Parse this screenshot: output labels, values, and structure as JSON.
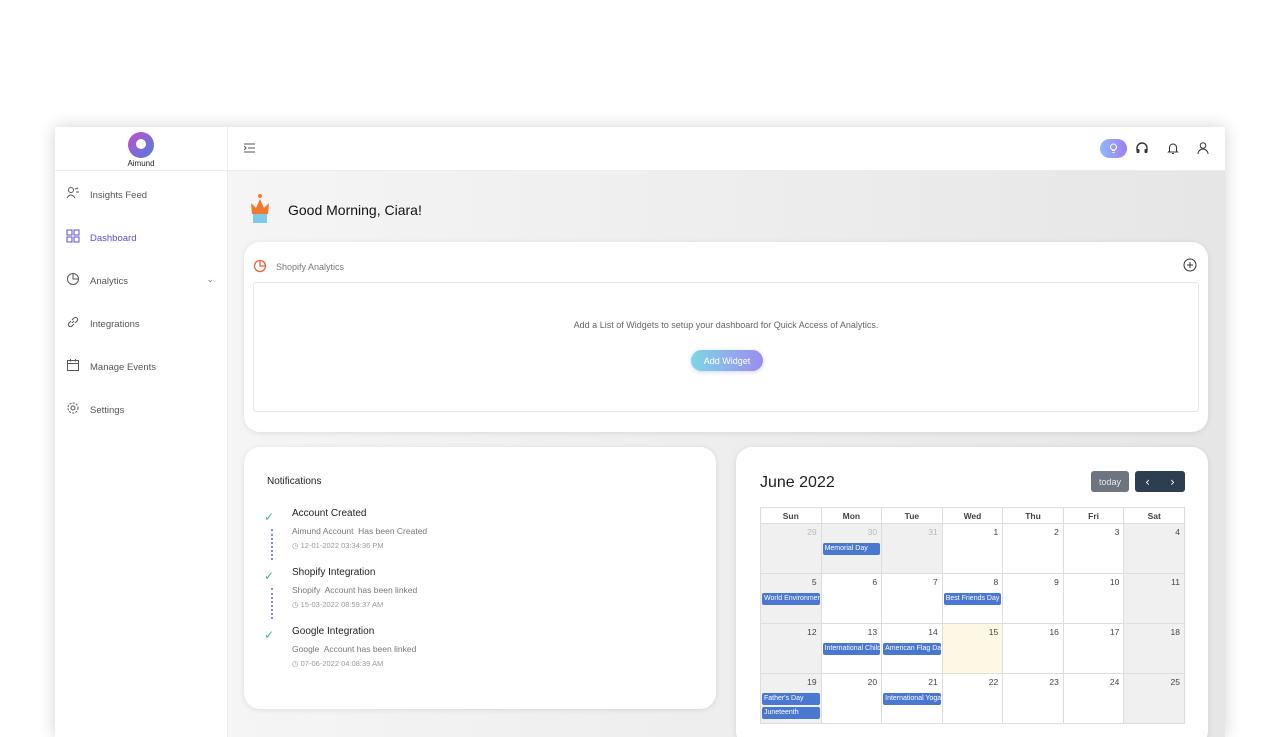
{
  "app": {
    "logo_text": "Aimund"
  },
  "sidebar": {
    "items": [
      {
        "label": "Insights Feed",
        "icon": "insights-icon",
        "active": false
      },
      {
        "label": "Dashboard",
        "icon": "grid-icon",
        "active": true
      },
      {
        "label": "Analytics",
        "icon": "pie-chart-icon",
        "active": false,
        "expandable": true
      },
      {
        "label": "Integrations",
        "icon": "link-icon",
        "active": false
      },
      {
        "label": "Manage Events",
        "icon": "calendar-icon",
        "active": false
      },
      {
        "label": "Settings",
        "icon": "gear-icon",
        "active": false
      }
    ]
  },
  "header": {
    "icons": [
      "menu-toggle-icon",
      "bulb-icon",
      "headphones-icon",
      "bell-icon",
      "user-icon"
    ]
  },
  "main": {
    "greeting": "Good Morning, Ciara!"
  },
  "shopify": {
    "title": "Shopify Analytics",
    "empty_message": "Add a List of Widgets to setup your dashboard for Quick Access of Analytics.",
    "add_widget_label": "Add Widget"
  },
  "notifications": {
    "title": "Notifications",
    "items": [
      {
        "title": "Account Created",
        "source": "Aimund Account",
        "message": "Has been Created",
        "time": "12-01-2022 03:34:36 PM"
      },
      {
        "title": "Shopify Integration",
        "source": "Shopify",
        "message": "Account has been linked",
        "time": "15-03-2022 08:59:37 AM"
      },
      {
        "title": "Google Integration",
        "source": "Google",
        "message": "Account has been linked",
        "time": "07-06-2022 04:08:39 AM"
      }
    ]
  },
  "calendar": {
    "title": "June 2022",
    "today_label": "today",
    "prev_label": "‹",
    "next_label": "›",
    "weekdays": [
      "Sun",
      "Mon",
      "Tue",
      "Wed",
      "Thu",
      "Fri",
      "Sat"
    ],
    "weeks": [
      [
        {
          "d": "29",
          "other": true
        },
        {
          "d": "30",
          "other": true,
          "events": [
            "Memorial Day"
          ]
        },
        {
          "d": "31",
          "other": true
        },
        {
          "d": "1"
        },
        {
          "d": "2"
        },
        {
          "d": "3"
        },
        {
          "d": "4"
        }
      ],
      [
        {
          "d": "5",
          "events": [
            "World Environment Day"
          ]
        },
        {
          "d": "6"
        },
        {
          "d": "7"
        },
        {
          "d": "8",
          "events": [
            "Best Friends Day"
          ]
        },
        {
          "d": "9"
        },
        {
          "d": "10"
        },
        {
          "d": "11"
        }
      ],
      [
        {
          "d": "12"
        },
        {
          "d": "13",
          "events": [
            "International Children's Day"
          ]
        },
        {
          "d": "14",
          "events": [
            "American Flag Day"
          ]
        },
        {
          "d": "15",
          "today": true
        },
        {
          "d": "16"
        },
        {
          "d": "17"
        },
        {
          "d": "18"
        }
      ],
      [
        {
          "d": "19",
          "events": [
            "Father's Day",
            "Juneteenth"
          ]
        },
        {
          "d": "20"
        },
        {
          "d": "21",
          "events": [
            "International Yoga Day"
          ]
        },
        {
          "d": "22"
        },
        {
          "d": "23"
        },
        {
          "d": "24"
        },
        {
          "d": "25"
        }
      ]
    ]
  }
}
